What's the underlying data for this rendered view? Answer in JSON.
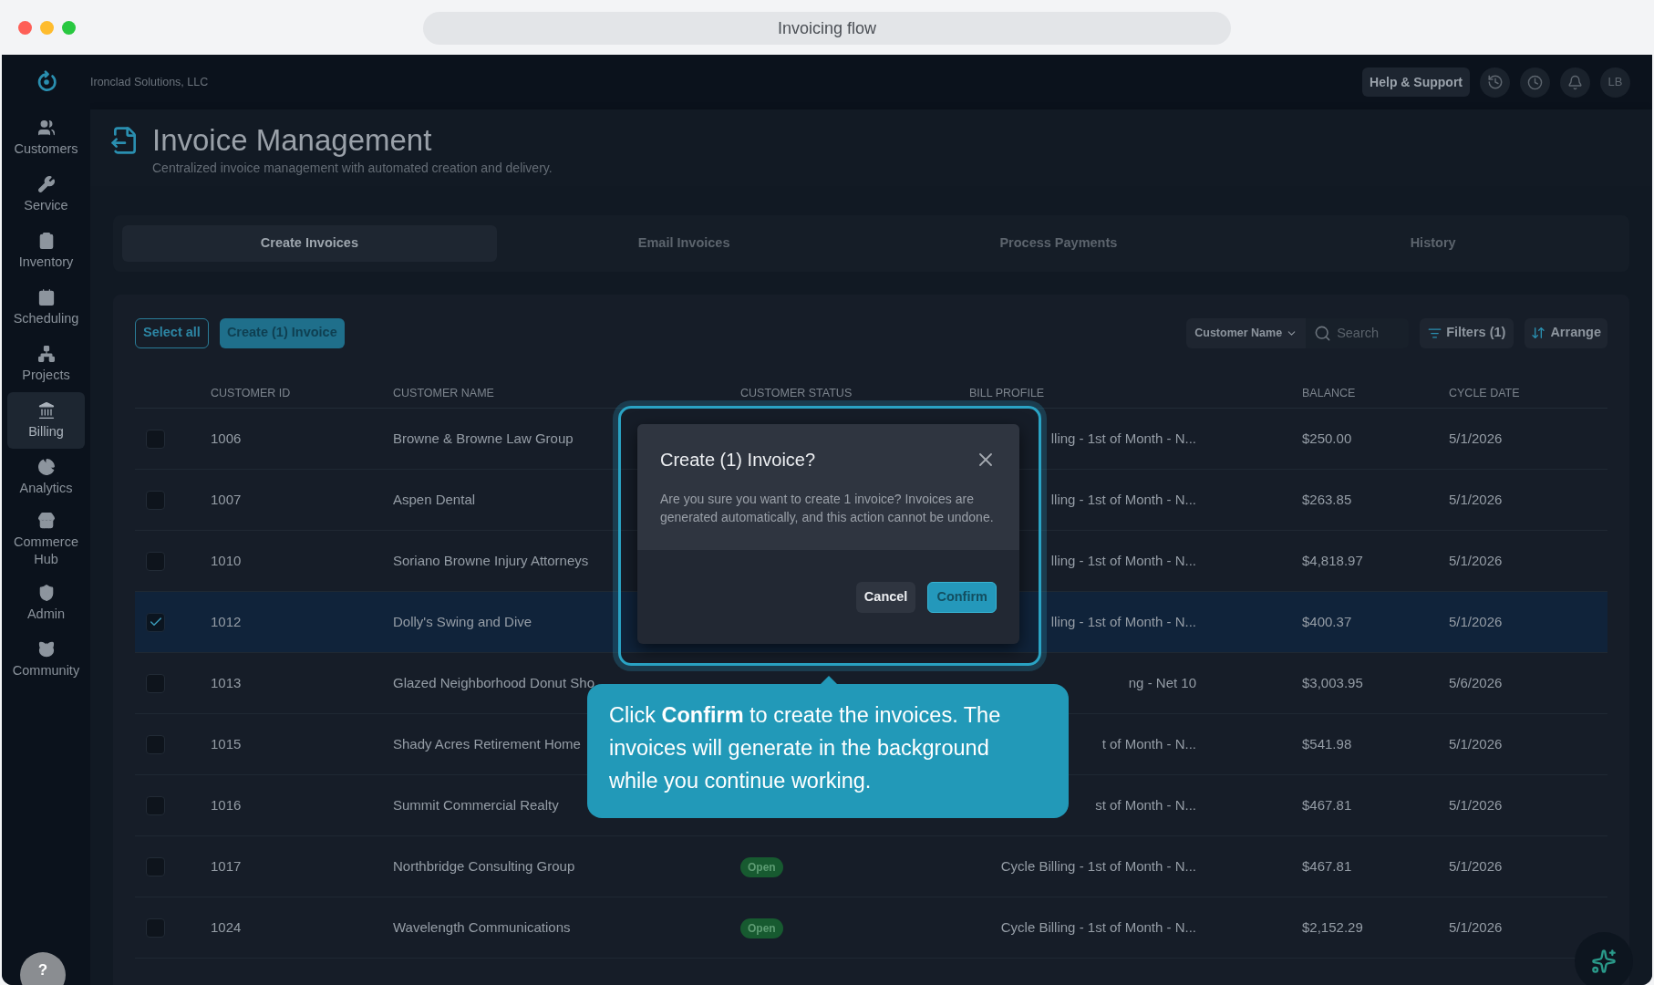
{
  "window": {
    "title": "Invoicing flow"
  },
  "header": {
    "company": "Ironclad Solutions, LLC",
    "help_button": "Help & Support",
    "avatar": "LB"
  },
  "sidebar": {
    "items": [
      {
        "label": "Customers",
        "selected": false
      },
      {
        "label": "Service",
        "selected": false
      },
      {
        "label": "Inventory",
        "selected": false
      },
      {
        "label": "Scheduling",
        "selected": false
      },
      {
        "label": "Projects",
        "selected": false
      },
      {
        "label": "Billing",
        "selected": true
      },
      {
        "label": "Analytics",
        "selected": false
      },
      {
        "label": "Commerce Hub",
        "selected": false
      },
      {
        "label": "Admin",
        "selected": false
      },
      {
        "label": "Community",
        "selected": false
      }
    ],
    "help_button": "?"
  },
  "page": {
    "title": "Invoice Management",
    "subtitle": "Centralized invoice management with automated creation and delivery."
  },
  "tabs": [
    {
      "label": "Create Invoices",
      "selected": true
    },
    {
      "label": "Email Invoices",
      "selected": false
    },
    {
      "label": "Process Payments",
      "selected": false
    },
    {
      "label": "History",
      "selected": false
    }
  ],
  "toolbar": {
    "select_all": "Select all",
    "create_button": "Create (1) Invoice",
    "search_by": "Customer Name",
    "search_placeholder": "Search",
    "filters_button": "Filters (1)",
    "arrange_button": "Arrange"
  },
  "table": {
    "columns": [
      "CUSTOMER ID",
      "CUSTOMER NAME",
      "CUSTOMER STATUS",
      "BILL PROFILE",
      "BALANCE",
      "CYCLE DATE"
    ],
    "rows": [
      {
        "checked": false,
        "selected": false,
        "customer_id": "1006",
        "customer_name": "Browne & Browne Law Group",
        "bill_profile": "lling - 1st of Month - N...",
        "balance": "$250.00",
        "cycle_date": "5/1/2026"
      },
      {
        "checked": false,
        "selected": false,
        "customer_id": "1007",
        "customer_name": "Aspen Dental",
        "bill_profile": "lling - 1st of Month - N...",
        "balance": "$263.85",
        "cycle_date": "5/1/2026"
      },
      {
        "checked": false,
        "selected": false,
        "customer_id": "1010",
        "customer_name": "Soriano Browne Injury Attorneys",
        "bill_profile": "lling - 1st of Month - N...",
        "balance": "$4,818.97",
        "cycle_date": "5/1/2026"
      },
      {
        "checked": true,
        "selected": true,
        "customer_id": "1012",
        "customer_name": "Dolly's Swing and Dive",
        "bill_profile": "lling - 1st of Month - N...",
        "balance": "$400.37",
        "cycle_date": "5/1/2026"
      },
      {
        "checked": false,
        "selected": false,
        "customer_id": "1013",
        "customer_name": "Glazed Neighborhood Donut Sho",
        "bill_profile": "ng - Net 10",
        "balance": "$3,003.95",
        "cycle_date": "5/6/2026"
      },
      {
        "checked": false,
        "selected": false,
        "customer_id": "1015",
        "customer_name": "Shady Acres Retirement Home",
        "bill_profile": "t of Month - N...",
        "balance": "$541.98",
        "cycle_date": "5/1/2026"
      },
      {
        "checked": false,
        "selected": false,
        "customer_id": "1016",
        "customer_name": "Summit Commercial Realty",
        "bill_profile": "st of Month - N...",
        "balance": "$467.81",
        "cycle_date": "5/1/2026"
      },
      {
        "checked": false,
        "selected": false,
        "customer_id": "1017",
        "customer_name": "Northbridge Consulting Group",
        "customer_status": "Open",
        "bill_profile": "Cycle Billing - 1st of Month - N...",
        "balance": "$467.81",
        "cycle_date": "5/1/2026"
      },
      {
        "checked": false,
        "selected": false,
        "customer_id": "1024",
        "customer_name": "Wavelength Communications",
        "customer_status": "Open",
        "bill_profile": "Cycle Billing - 1st of Month - N...",
        "balance": "$2,152.29",
        "cycle_date": "5/1/2026"
      }
    ]
  },
  "dialog": {
    "title": "Create (1) Invoice?",
    "message": "Are you sure you want to create 1 invoice? Invoices are generated automatically, and this action cannot be undone.",
    "buttons": [
      {
        "label": "Cancel",
        "kind": "secondary"
      },
      {
        "label": "Confirm",
        "kind": "primary"
      }
    ]
  },
  "tooltip": {
    "text": "Click **Confirm** to create the invoices. The invoices will generate in the background while you continue working."
  }
}
